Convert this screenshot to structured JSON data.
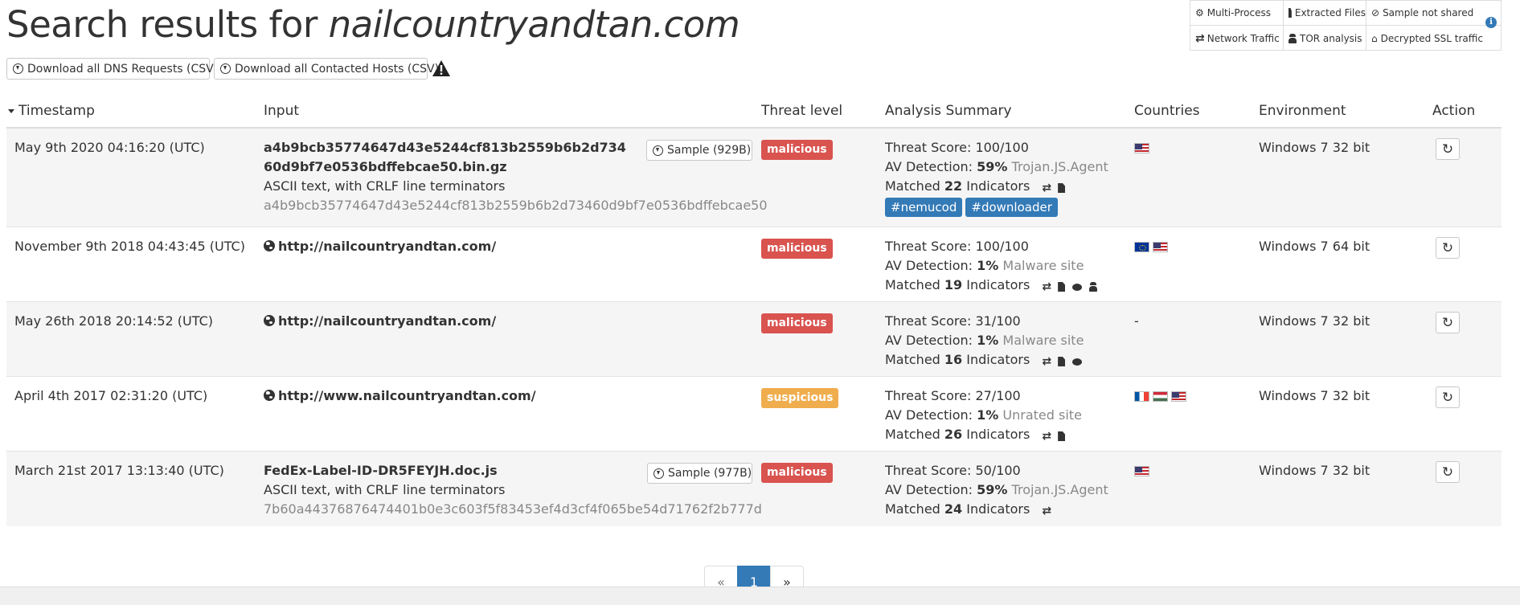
{
  "page": {
    "title_prefix": "Search results for ",
    "title_query": "nailcountryandtan.com"
  },
  "actions": {
    "download_dns": "Download all DNS Requests (CSV)",
    "download_hosts": "Download all Contacted Hosts (CSV)"
  },
  "legend": {
    "items": [
      {
        "label": "Multi-Process",
        "icon": "gears-icon"
      },
      {
        "label": "Extracted Files",
        "icon": "file-icon"
      },
      {
        "label": "Sample not shared",
        "icon": "eye-slash-icon"
      },
      {
        "label": "Network Traffic",
        "icon": "exchange-icon"
      },
      {
        "label": "TOR analysis",
        "icon": "user-secret-icon"
      },
      {
        "label": "Decrypted SSL traffic",
        "icon": "bank-icon"
      }
    ]
  },
  "table": {
    "headers": {
      "timestamp": "Timestamp",
      "input": "Input",
      "threat": "Threat level",
      "analysis": "Analysis Summary",
      "countries": "Countries",
      "environment": "Environment",
      "action": "Action"
    },
    "rows": [
      {
        "timestamp": "May 9th 2020 04:16:20 (UTC)",
        "input_name": "a4b9bcb35774647d43e5244cf813b2559b6b2d73460d9bf7e0536bdffebcae50.bin.gz",
        "input_type": "ASCII text, with CRLF line terminators",
        "input_hash": "a4b9bcb35774647d43e5244cf813b2559b6b2d73460d9bf7e0536bdffebcae50",
        "sample_label": "Sample (929B)",
        "threat": "malicious",
        "threat_score_label": "Threat Score: ",
        "threat_score": "100/100",
        "av_label": "AV Detection: ",
        "av_pct": "59%",
        "av_name": "Trojan.JS.Agent",
        "matched_label": "Matched ",
        "matched_count": "22",
        "indicators_label": " Indicators",
        "tags": [
          "#nemucod",
          "#downloader"
        ],
        "countries": [
          "us"
        ],
        "environment": "Windows 7 32 bit"
      },
      {
        "timestamp": "November 9th 2018 04:43:45 (UTC)",
        "input_url": "http://nailcountryandtan.com/",
        "threat": "malicious",
        "threat_score_label": "Threat Score: ",
        "threat_score": "100/100",
        "av_label": "AV Detection: ",
        "av_pct": "1%",
        "av_name": "Malware site",
        "matched_label": "Matched ",
        "matched_count": "19",
        "indicators_label": " Indicators",
        "countries": [
          "eu",
          "us"
        ],
        "environment": "Windows 7 64 bit"
      },
      {
        "timestamp": "May 26th 2018 20:14:52 (UTC)",
        "input_url": "http://nailcountryandtan.com/",
        "threat": "malicious",
        "threat_score_label": "Threat Score: ",
        "threat_score": "31/100",
        "av_label": "AV Detection: ",
        "av_pct": "1%",
        "av_name": "Malware site",
        "matched_label": "Matched ",
        "matched_count": "16",
        "indicators_label": " Indicators",
        "countries_text": "-",
        "environment": "Windows 7 32 bit"
      },
      {
        "timestamp": "April 4th 2017 02:31:20 (UTC)",
        "input_url": "http://www.nailcountryandtan.com/",
        "threat": "suspicious",
        "threat_score_label": "Threat Score: ",
        "threat_score": "27/100",
        "av_label": "AV Detection: ",
        "av_pct": "1%",
        "av_name": "Unrated site",
        "matched_label": "Matched ",
        "matched_count": "26",
        "indicators_label": " Indicators",
        "countries": [
          "fr",
          "hu",
          "us"
        ],
        "environment": "Windows 7 32 bit"
      },
      {
        "timestamp": "March 21st 2017 13:13:40 (UTC)",
        "input_name": "FedEx-Label-ID-DR5FEYJH.doc.js",
        "input_type": "ASCII text, with CRLF line terminators",
        "input_hash": "7b60a44376876474401b0e3c603f5f83453ef4d3cf4f065be54d71762f2b777d",
        "sample_label": "Sample (977B)",
        "threat": "malicious",
        "threat_score_label": "Threat Score: ",
        "threat_score": "50/100",
        "av_label": "AV Detection: ",
        "av_pct": "59%",
        "av_name": "Trojan.JS.Agent",
        "matched_label": "Matched ",
        "matched_count": "24",
        "indicators_label": " Indicators",
        "countries": [
          "us"
        ],
        "environment": "Windows 7 32 bit"
      }
    ]
  },
  "pagination": {
    "prev": "«",
    "current": "1",
    "next": "»"
  },
  "colors": {
    "malicious": "#d9534f",
    "suspicious": "#f0ad4e",
    "tag": "#337ab7"
  }
}
